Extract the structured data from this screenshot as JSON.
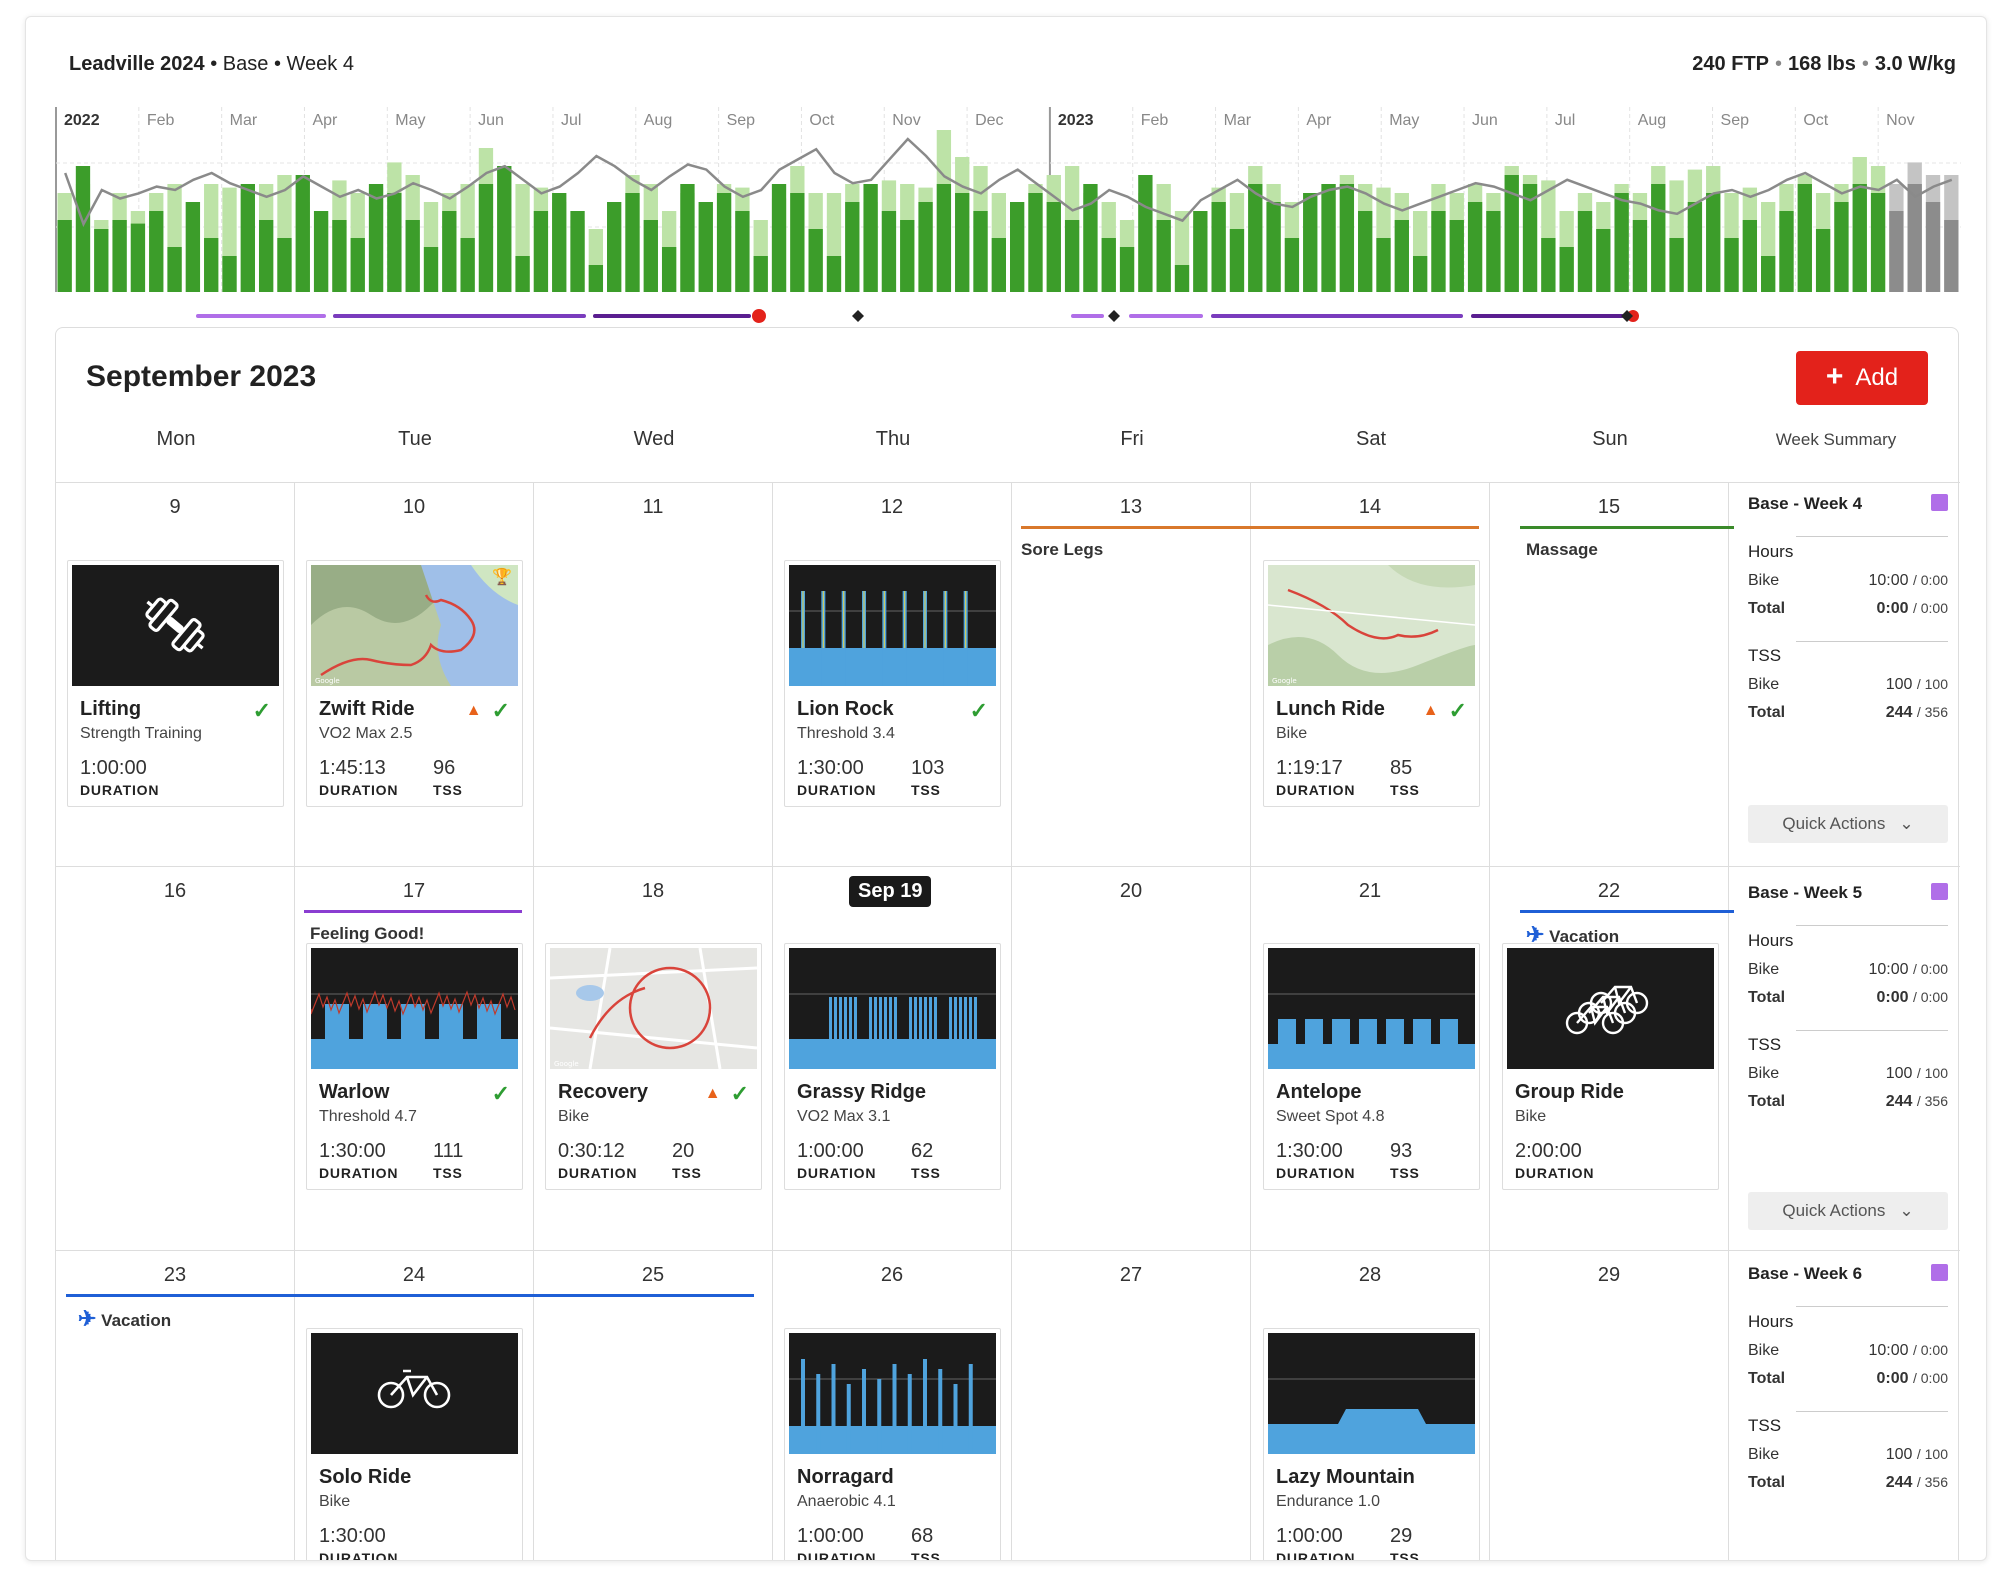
{
  "header": {
    "plan": "Leadville 2024",
    "phase": "Base",
    "week": "Week 4",
    "ftp": "240 FTP",
    "weight": "168 lbs",
    "wkg": "3.0 W/kg",
    "sep": "•"
  },
  "timeline": {
    "months": [
      "2022",
      "Feb",
      "Mar",
      "Apr",
      "May",
      "Jun",
      "Jul",
      "Aug",
      "Sep",
      "Oct",
      "Nov",
      "Dec",
      "2023",
      "Feb",
      "Mar",
      "Apr",
      "May",
      "Jun",
      "Jul",
      "Aug",
      "Sep",
      "Oct",
      "Nov"
    ],
    "colors": {
      "dark": "#3c9d2a",
      "light": "#bde3a7",
      "grey": "#c4c4c4",
      "line": "#8a8a8a",
      "race": "#e3221b",
      "purple1": "#b06ee8",
      "purple2": "#7a3cbd",
      "purple3": "#5a1e90"
    },
    "planned_tss": [
      55,
      60,
      40,
      55,
      45,
      55,
      60,
      50,
      60,
      58,
      55,
      60,
      65,
      50,
      40,
      62,
      55,
      58,
      72,
      65,
      50,
      55,
      60,
      80,
      70,
      60,
      58,
      50,
      40,
      35,
      40,
      65,
      60,
      45,
      55,
      50,
      60,
      58,
      40,
      52,
      70,
      55,
      55,
      60,
      50,
      62,
      60,
      58,
      90,
      75,
      70,
      55,
      40,
      60,
      65,
      70,
      55,
      50,
      40,
      55,
      60,
      45,
      40,
      58,
      55,
      70,
      60,
      50,
      55,
      60,
      65,
      60,
      58,
      55,
      45,
      60,
      55,
      60,
      55,
      70,
      65,
      62,
      45,
      55,
      50,
      60,
      55,
      70,
      62,
      68,
      70,
      55,
      58,
      50,
      60,
      65,
      55,
      60,
      75,
      70,
      60,
      72,
      65,
      65
    ],
    "completed_tss": [
      40,
      70,
      35,
      40,
      38,
      45,
      25,
      50,
      30,
      20,
      60,
      40,
      30,
      65,
      45,
      40,
      30,
      60,
      55,
      40,
      25,
      45,
      30,
      60,
      70,
      20,
      45,
      55,
      45,
      15,
      50,
      55,
      40,
      25,
      60,
      50,
      55,
      45,
      20,
      60,
      55,
      35,
      20,
      50,
      60,
      45,
      40,
      50,
      60,
      55,
      45,
      30,
      50,
      55,
      50,
      40,
      60,
      30,
      25,
      65,
      40,
      15,
      45,
      50,
      35,
      60,
      50,
      30,
      55,
      60,
      60,
      45,
      30,
      40,
      20,
      45,
      40,
      50,
      45,
      65,
      60,
      30,
      25,
      45,
      35,
      55,
      40,
      60,
      30,
      50,
      55,
      30,
      40,
      20,
      45,
      60,
      35,
      50,
      60,
      55,
      45,
      60,
      50,
      40
    ],
    "fitness_line": [
      70,
      40,
      60,
      55,
      58,
      62,
      60,
      66,
      70,
      64,
      60,
      56,
      60,
      68,
      62,
      56,
      60,
      55,
      58,
      64,
      60,
      55,
      62,
      70,
      74,
      66,
      58,
      62,
      70,
      80,
      74,
      66,
      60,
      68,
      75,
      72,
      62,
      56,
      60,
      72,
      78,
      84,
      70,
      64,
      66,
      78,
      90,
      80,
      68,
      62,
      58,
      66,
      72,
      64,
      56,
      48,
      52,
      60,
      56,
      50,
      46,
      42,
      54,
      60,
      66,
      58,
      52,
      50,
      56,
      60,
      62,
      58,
      52,
      48,
      52,
      56,
      60,
      64,
      62,
      58,
      54,
      60,
      66,
      62,
      58,
      54,
      52,
      48,
      46,
      52,
      58,
      60,
      56,
      60,
      66,
      70,
      64,
      58,
      62,
      60,
      66,
      56,
      62,
      66
    ]
  },
  "calendar": {
    "title": "September 2023",
    "add_label": "Add",
    "add_plus": "+",
    "days": [
      "Mon",
      "Tue",
      "Wed",
      "Thu",
      "Fri",
      "Sat",
      "Sun"
    ],
    "summary_header": "Week Summary",
    "weeks": [
      {
        "dates": [
          "9",
          "10",
          "11",
          "12",
          "13",
          "14",
          "15"
        ]
      },
      {
        "dates": [
          "16",
          "17",
          "18",
          "Sep 19",
          "20",
          "21",
          "22"
        ]
      },
      {
        "dates": [
          "23",
          "24",
          "25",
          "26",
          "27",
          "28",
          "29"
        ]
      }
    ],
    "notes": {
      "sore": "Sore Legs",
      "massage": "Massage",
      "feeling": "Feeling Good!",
      "vacation1": "Vacation",
      "vacation2": "Vacation"
    },
    "cards": {
      "lifting": {
        "title": "Lifting",
        "sub": "Strength Training",
        "dur": "1:00:00",
        "dur_label": "DURATION"
      },
      "zwift": {
        "title": "Zwift Ride",
        "sub": "VO2 Max 2.5",
        "dur": "1:45:13",
        "tss": "96",
        "dur_label": "DURATION",
        "tss_label": "TSS"
      },
      "lion": {
        "title": "Lion Rock",
        "sub": "Threshold 3.4",
        "dur": "1:30:00",
        "tss": "103",
        "dur_label": "DURATION",
        "tss_label": "TSS"
      },
      "lunch": {
        "title": "Lunch Ride",
        "sub": "Bike",
        "dur": "1:19:17",
        "tss": "85",
        "dur_label": "DURATION",
        "tss_label": "TSS"
      },
      "warlow": {
        "title": "Warlow",
        "sub": "Threshold 4.7",
        "dur": "1:30:00",
        "tss": "111",
        "dur_label": "DURATION",
        "tss_label": "TSS"
      },
      "recovery": {
        "title": "Recovery",
        "sub": "Bike",
        "dur": "0:30:12",
        "tss": "20",
        "dur_label": "DURATION",
        "tss_label": "TSS"
      },
      "grassy": {
        "title": "Grassy Ridge",
        "sub": "VO2 Max 3.1",
        "dur": "1:00:00",
        "tss": "62",
        "dur_label": "DURATION",
        "tss_label": "TSS"
      },
      "antelope": {
        "title": "Antelope",
        "sub": "Sweet Spot 4.8",
        "dur": "1:30:00",
        "tss": "93",
        "dur_label": "DURATION",
        "tss_label": "TSS"
      },
      "group": {
        "title": "Group Ride",
        "sub": "Bike",
        "dur": "2:00:00",
        "dur_label": "DURATION"
      },
      "solo": {
        "title": "Solo Ride",
        "sub": "Bike",
        "dur": "1:30:00",
        "dur_label": "DURATION"
      },
      "norragard": {
        "title": "Norragard",
        "sub": "Anaerobic 4.1",
        "dur": "1:00:00",
        "tss": "68",
        "dur_label": "DURATION",
        "tss_label": "TSS"
      },
      "lazy": {
        "title": "Lazy Mountain",
        "sub": "Endurance 1.0",
        "dur": "1:00:00",
        "tss": "29",
        "dur_label": "DURATION",
        "tss_label": "TSS"
      }
    },
    "summaries": [
      {
        "title": "Base - Week 4",
        "hours": "Hours",
        "bike": "Bike",
        "bike_val": "10:00",
        "bike_of": "/ 0:00",
        "total": "Total",
        "total_val": "0:00",
        "total_of": "/ 0:00",
        "tss": "TSS",
        "tss_bike": "100",
        "tss_bike_of": "/ 100",
        "tss_total": "244",
        "tss_total_of": "/ 356",
        "qa": "Quick Actions"
      },
      {
        "title": "Base - Week 5",
        "hours": "Hours",
        "bike": "Bike",
        "bike_val": "10:00",
        "bike_of": "/ 0:00",
        "total": "Total",
        "total_val": "0:00",
        "total_of": "/ 0:00",
        "tss": "TSS",
        "tss_bike": "100",
        "tss_bike_of": "/ 100",
        "tss_total": "244",
        "tss_total_of": "/ 356",
        "qa": "Quick Actions"
      },
      {
        "title": "Base - Week 6",
        "hours": "Hours",
        "bike": "Bike",
        "bike_val": "10:00",
        "bike_of": "/ 0:00",
        "total": "Total",
        "total_val": "0:00",
        "total_of": "/ 0:00",
        "tss": "TSS",
        "tss_bike": "100",
        "tss_bike_of": "/ 100",
        "tss_total": "244",
        "tss_total_of": "/ 356"
      }
    ]
  }
}
